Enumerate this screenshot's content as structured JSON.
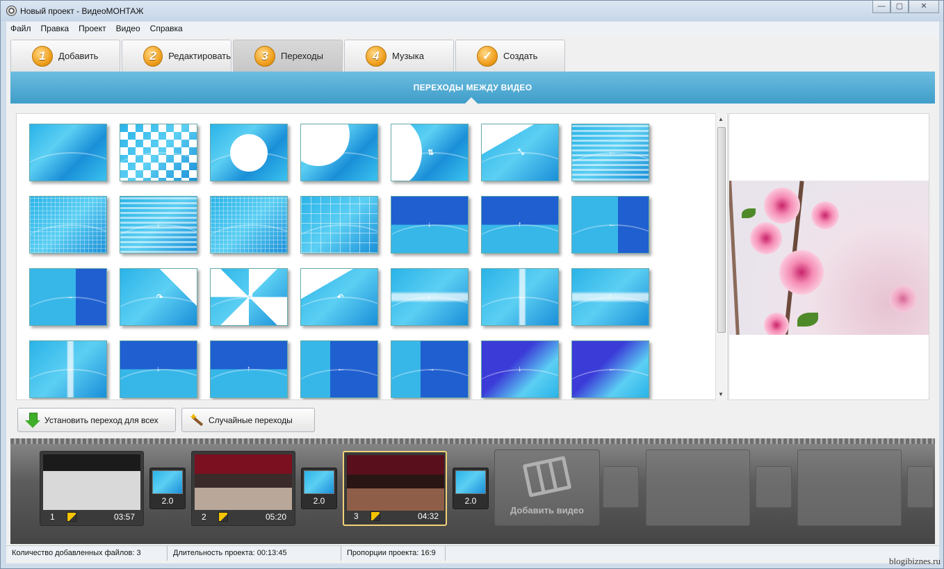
{
  "window": {
    "title": "Новый проект - ВидеоМОНТАЖ",
    "controls": [
      "—",
      "▢",
      "✕"
    ]
  },
  "menu": [
    "Файл",
    "Правка",
    "Проект",
    "Видео",
    "Справка"
  ],
  "tabs": [
    {
      "num": "1",
      "label": "Добавить"
    },
    {
      "num": "2",
      "label": "Редактировать"
    },
    {
      "num": "3",
      "label": "Переходы"
    },
    {
      "num": "4",
      "label": "Музыка"
    },
    {
      "num": "",
      "label": "Создать"
    }
  ],
  "section_title": "ПЕРЕХОДЫ МЕЖДУ ВИДЕО",
  "buttons": {
    "apply_all": "Установить переход для всех",
    "random": "Случайные переходы"
  },
  "timeline": {
    "clips": [
      {
        "num": "1",
        "duration": "03:57"
      },
      {
        "num": "2",
        "duration": "05:20"
      },
      {
        "num": "3",
        "duration": "04:32"
      }
    ],
    "transitions": [
      "2.0",
      "2.0",
      "2.0"
    ],
    "add_video": "Добавить видео"
  },
  "status": {
    "files": "Количество добавленных файлов: 3",
    "duration": "Длительность проекта:  00:13:45",
    "ratio": "Пропорции проекта:  16:9"
  },
  "watermark": "blogibiznes.ru",
  "colors": {
    "accent": "#4ba9d3",
    "tab_badge": "#f0a01e"
  }
}
